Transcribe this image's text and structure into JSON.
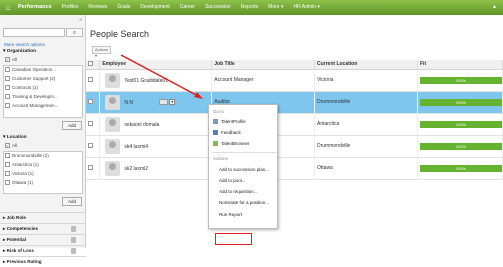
{
  "nav": {
    "items": [
      "Performance",
      "Profiles",
      "Reviews",
      "Goals",
      "Development",
      "Career",
      "Succession",
      "Reports",
      "More",
      "HR Admin"
    ]
  },
  "sidebar": {
    "more_search": "More search options",
    "org_label": "Organization",
    "org_items": [
      "All",
      "Canadian Operation...",
      "Customer Support (2)",
      "Contracts (1)",
      "Training & Developm...",
      "Account Managemen..."
    ],
    "add_label": "Add",
    "loc_label": "Location",
    "loc_items": [
      "All",
      "Drummondville (2)",
      "Antarctica (1)",
      "Victoria (1)",
      "Ottawa (1)"
    ],
    "bottom_sections": [
      "Job Role",
      "Competencies",
      "Potential",
      "Risk of Loss",
      "Previous Rating"
    ]
  },
  "main": {
    "title": "People Search",
    "actions_label": "Actions"
  },
  "table": {
    "headers": [
      "Employee",
      "Job Title",
      "Current Location",
      "Fit"
    ],
    "rows": [
      {
        "name": "Test01 Gradidate01",
        "job": "Account Manager",
        "location": "Victoria",
        "fit": "100%"
      },
      {
        "name": "N N",
        "job": "Auditor",
        "location": "Drummondville",
        "fit": "100%"
      },
      {
        "name": "sekaoni domala",
        "job": "",
        "location": "Antarctica",
        "fit": "100%"
      },
      {
        "name": "sk4 laxmi4",
        "job": "",
        "location": "Drummondville",
        "fit": "100%"
      },
      {
        "name": "sk2 laxmi2",
        "job": "",
        "location": "Ottawa",
        "fit": "100%"
      }
    ]
  },
  "menu": {
    "goto_label": "Go to",
    "goto_items": [
      "TalentProfile",
      "Feedback",
      "TalentBrowser"
    ],
    "actions_label": "Actions",
    "action_items": [
      "Add to succession plan...",
      "Add to pool...",
      "Add to requisition...",
      "Nominate for a position...",
      "Run Report"
    ]
  },
  "colors": {
    "nav": "#6aa82f",
    "highlight_row": "#7fc6ef",
    "fit_bar": "#65b32e",
    "callout": "#e02020"
  }
}
